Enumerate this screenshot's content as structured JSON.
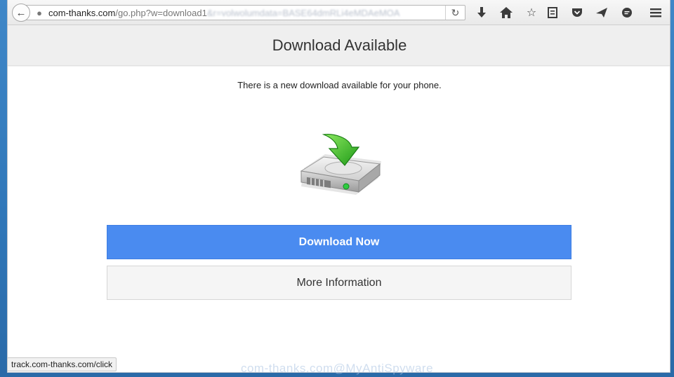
{
  "browser": {
    "url_domain": "com-thanks.com",
    "url_path": "/go.php?w=download1",
    "url_obscured": "&r=volwolumdata=BASE64dmRLi4eMDAeMOA",
    "status_text": "track.com-thanks.com/click"
  },
  "toolbar": {
    "back_icon": "back-arrow-icon",
    "globe_icon": "globe-icon",
    "reload_icon": "reload-icon",
    "icons": [
      "download-icon",
      "home-icon",
      "bookmark-star-icon",
      "reading-list-icon",
      "pocket-icon",
      "send-icon",
      "chat-icon",
      "menu-icon"
    ]
  },
  "page": {
    "title": "Download Available",
    "subtitle": "There is a new download available for your phone.",
    "primary_button": "Download Now",
    "secondary_button": "More Information"
  },
  "colors": {
    "primary": "#4a8bf0",
    "arrow_green": "#3fbf2a"
  },
  "watermark": "com-thanks.com@MyAntiSpyware"
}
